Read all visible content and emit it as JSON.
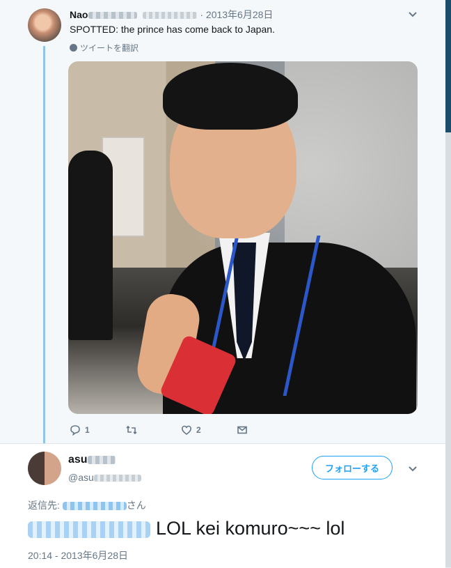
{
  "parent_tweet": {
    "author_name_visible": "Nao",
    "separator": "·",
    "date": "2013年6月28日",
    "text": "SPOTTED: the prince has come back to Japan.",
    "translate_label": "ツイートを翻訳",
    "reply_count": "1",
    "like_count": "2"
  },
  "reply_tweet": {
    "author_name_visible": "asu",
    "handle_visible": "@asu",
    "follow_button_label": "フォローする",
    "reply_to_label": "返信先:",
    "reply_to_suffix": "さん",
    "text": "LOL kei komuro~~~ lol",
    "timestamp": "20:14 - 2013年6月28日"
  },
  "colors": {
    "accent": "#1da1f2",
    "muted": "#657786",
    "text": "#14171a",
    "background": "#e6ecf0",
    "parent_background": "#f5f8fa",
    "thread_line": "#8ec6e9"
  },
  "icons": {
    "reply": "speech-bubble-icon",
    "retweet": "retweet-icon",
    "like": "heart-icon",
    "message": "envelope-icon",
    "menu": "chevron-down-icon",
    "translate": "globe-icon"
  }
}
